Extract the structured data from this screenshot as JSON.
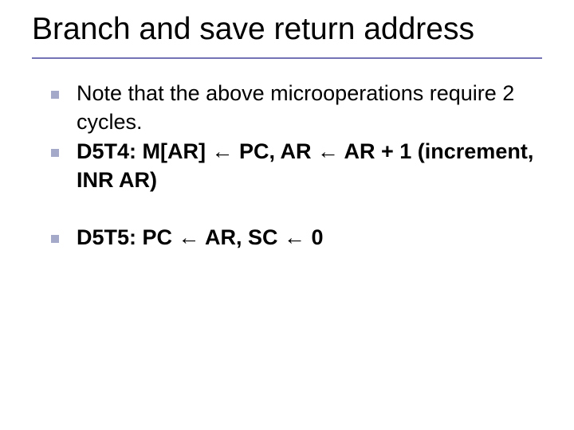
{
  "slide": {
    "title": "Branch and save return address"
  },
  "bullets": {
    "b1": "Note that the above microoperations require 2 cycles.",
    "b2": "D5T4: M[AR] ← PC, AR ← AR + 1 (increment, INR AR)",
    "b3": "D5T5: PC ← AR, SC ← 0"
  }
}
